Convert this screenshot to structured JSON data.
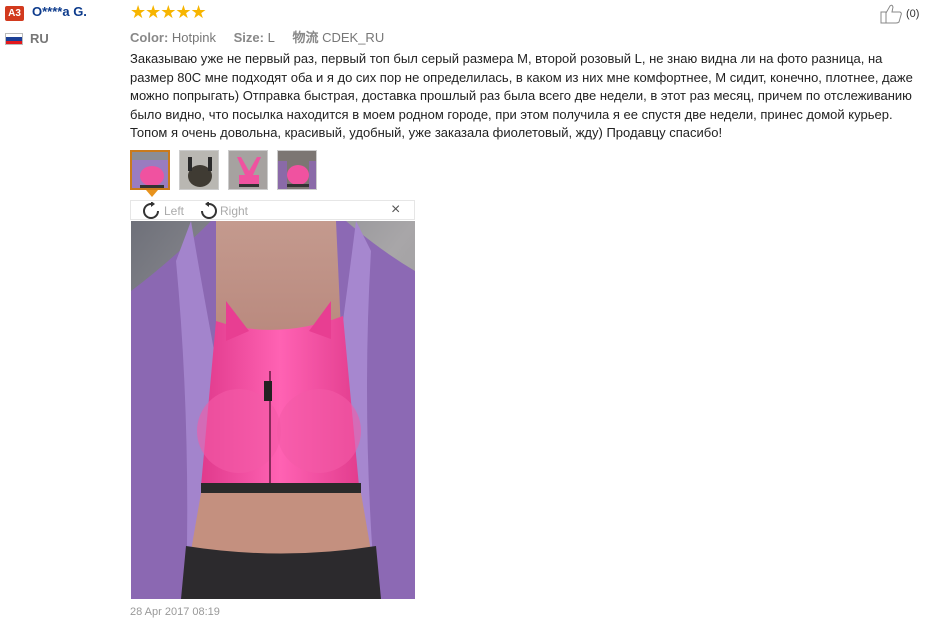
{
  "reviewer": {
    "badge": "A3",
    "name": "O****a G.",
    "country": "RU",
    "flag_colors": [
      "#ffffff",
      "#1c3f95",
      "#e4181c"
    ]
  },
  "rating": {
    "stars": "★★★★★",
    "value": 5,
    "max": 5,
    "color": "#f7b500"
  },
  "helpful": {
    "icon": "thumbs-up-icon",
    "count": "(0)"
  },
  "meta": {
    "color_label": "Color:",
    "color_value": "Hotpink",
    "size_label": "Size:",
    "size_value": "L",
    "shipping_label": "物流",
    "shipping_value": "CDEK_RU"
  },
  "review_text": "Заказываю уже не первый раз, первый топ был серый размера M, второй розовый L, не знаю видна ли на фото разница, на размер 80С мне подходят оба и я до сих пор не определилась, в каком из них мне комфортнее, M сидит, конечно, плотнее, даже можно попрыгать) Отправка быстрая, доставка прошлый раз была всего две недели, в этот раз месяц, причем по отслеживанию было видно, что посылка находится в моем родном городе, при этом получила я ее спустя две недели, принес домой курьер. Топом я очень довольна, красивый, удобный, уже заказала фиолетовый, жду) Продавцу спасибо!",
  "viewer": {
    "rotate_left": "Left",
    "rotate_right": "Right",
    "close": "×"
  },
  "date": "28 Apr 2017 08:19",
  "colors": {
    "accent": "#e8931d",
    "username": "#0d3b8c",
    "badge": "#d23a1e"
  }
}
